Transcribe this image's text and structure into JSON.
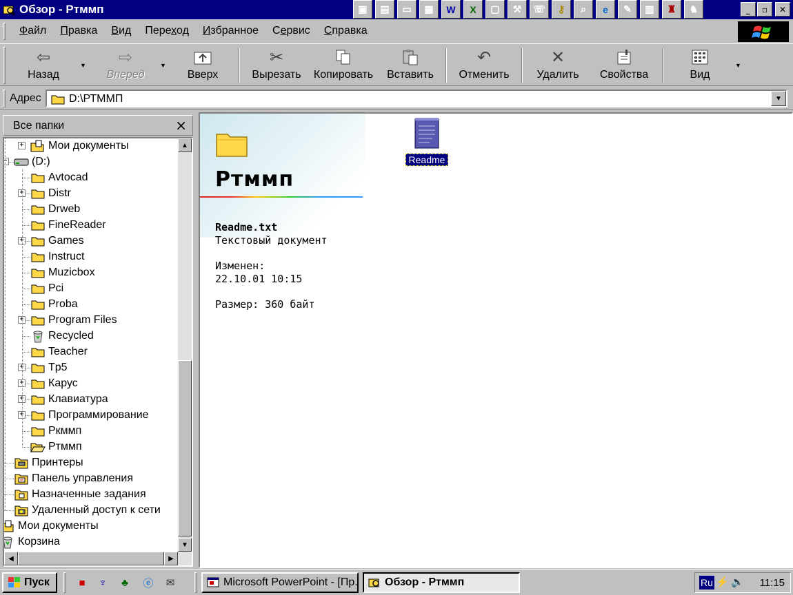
{
  "window": {
    "title": "Обзор - Ртммп",
    "controls": {
      "minimize": "_",
      "maximize": "▫",
      "close": "✕"
    }
  },
  "quicklaunch_icons": [
    "office-icon",
    "notepad-icon",
    "folder-open-icon",
    "network-icon",
    "word-icon",
    "excel-icon",
    "screen-icon",
    "tool-icon",
    "dialer-icon",
    "key-icon",
    "magnifier-icon",
    "ie-icon",
    "paint-icon",
    "pdf-icon",
    "game-icon",
    "chess-icon"
  ],
  "menu": {
    "items": [
      {
        "label": "Файл",
        "accel": "Ф",
        "rest": "айл"
      },
      {
        "label": "Правка",
        "accel": "П",
        "rest": "равка"
      },
      {
        "label": "Вид",
        "accel": "В",
        "rest": "ид"
      },
      {
        "label": "Переход",
        "pre": "Пере",
        "accel": "х",
        "rest": "од"
      },
      {
        "label": "Избранное",
        "accel": "И",
        "rest": "збранное"
      },
      {
        "label": "Сервис",
        "pre": "С",
        "accel": "е",
        "rest": "рвис"
      },
      {
        "label": "Справка",
        "accel": "С",
        "rest": "правка"
      }
    ]
  },
  "toolbar": {
    "back": "Назад",
    "forward": "Вперед",
    "up": "Вверх",
    "cut": "Вырезать",
    "copy": "Копировать",
    "paste": "Вставить",
    "undo": "Отменить",
    "delete": "Удалить",
    "properties": "Свойства",
    "view": "Вид"
  },
  "address": {
    "label": "Адрес",
    "value": "D:\\РТММП"
  },
  "folders_pane": {
    "title": "Все папки",
    "close": "×"
  },
  "tree": [
    {
      "label": "Мои документы",
      "icon": "my-documents-icon",
      "level": 1,
      "expandable": true
    },
    {
      "label": "(D:)",
      "icon": "drive-icon",
      "level": 0,
      "expandable": true,
      "expanded": true
    },
    {
      "label": "Avtocad",
      "icon": "folder-icon",
      "level": 1,
      "expandable": false
    },
    {
      "label": "Distr",
      "icon": "folder-icon",
      "level": 1,
      "expandable": true
    },
    {
      "label": "Drweb",
      "icon": "folder-icon",
      "level": 1,
      "expandable": false
    },
    {
      "label": "FineReader",
      "icon": "folder-icon",
      "level": 1,
      "expandable": false
    },
    {
      "label": "Games",
      "icon": "folder-icon",
      "level": 1,
      "expandable": true
    },
    {
      "label": "Instruct",
      "icon": "folder-icon",
      "level": 1,
      "expandable": false
    },
    {
      "label": "Muzicbox",
      "icon": "folder-icon",
      "level": 1,
      "expandable": false
    },
    {
      "label": "Pci",
      "icon": "folder-icon",
      "level": 1,
      "expandable": false
    },
    {
      "label": "Proba",
      "icon": "folder-icon",
      "level": 1,
      "expandable": false
    },
    {
      "label": "Program Files",
      "icon": "folder-icon",
      "level": 1,
      "expandable": true
    },
    {
      "label": "Recycled",
      "icon": "recycle-bin-icon",
      "level": 1,
      "expandable": false
    },
    {
      "label": "Teacher",
      "icon": "folder-icon",
      "level": 1,
      "expandable": false
    },
    {
      "label": "Tp5",
      "icon": "folder-icon",
      "level": 1,
      "expandable": true
    },
    {
      "label": "Карус",
      "icon": "folder-icon",
      "level": 1,
      "expandable": true
    },
    {
      "label": "Клавиатура",
      "icon": "folder-icon",
      "level": 1,
      "expandable": true
    },
    {
      "label": "Программирование",
      "icon": "folder-icon",
      "level": 1,
      "expandable": true
    },
    {
      "label": "Ркммп",
      "icon": "folder-icon",
      "level": 1,
      "expandable": false
    },
    {
      "label": "Ртммп",
      "icon": "folder-open-icon",
      "level": 1,
      "expandable": false,
      "selected": true
    },
    {
      "label": "Принтеры",
      "icon": "printer-folder-icon",
      "level": 0,
      "expandable": false
    },
    {
      "label": "Панель управления",
      "icon": "control-panel-icon",
      "level": 0,
      "expandable": false
    },
    {
      "label": "Назначенные задания",
      "icon": "scheduled-tasks-icon",
      "level": 0,
      "expandable": false
    },
    {
      "label": "Удаленный доступ к сети",
      "icon": "dialup-icon",
      "level": 0,
      "expandable": false
    },
    {
      "label": "Мои документы",
      "icon": "my-documents-icon",
      "level": -1,
      "expandable": false
    },
    {
      "label": "Корзина",
      "icon": "recycle-bin-icon",
      "level": -1,
      "expandable": false
    }
  ],
  "content": {
    "folder_title": "Ртммп",
    "selected_file": "Readme.txt",
    "file_type": "Текстовый документ",
    "modified_label": "Изменен:",
    "modified_value": "22.10.01 10:15",
    "size": "Размер: 360 байт",
    "file_icon_label": "Readme"
  },
  "taskbar": {
    "start": "Пуск",
    "tasks": [
      {
        "label": "Microsoft PowerPoint - [Пр...",
        "active": false
      },
      {
        "label": "Обзор - Ртммп",
        "active": true
      }
    ],
    "tray_lang": "Ru",
    "clock": "11:15"
  },
  "colors": {
    "titlebar": "#000080",
    "face": "#c0c0c0",
    "folder": "#ffd84a",
    "selection": "#000080"
  }
}
